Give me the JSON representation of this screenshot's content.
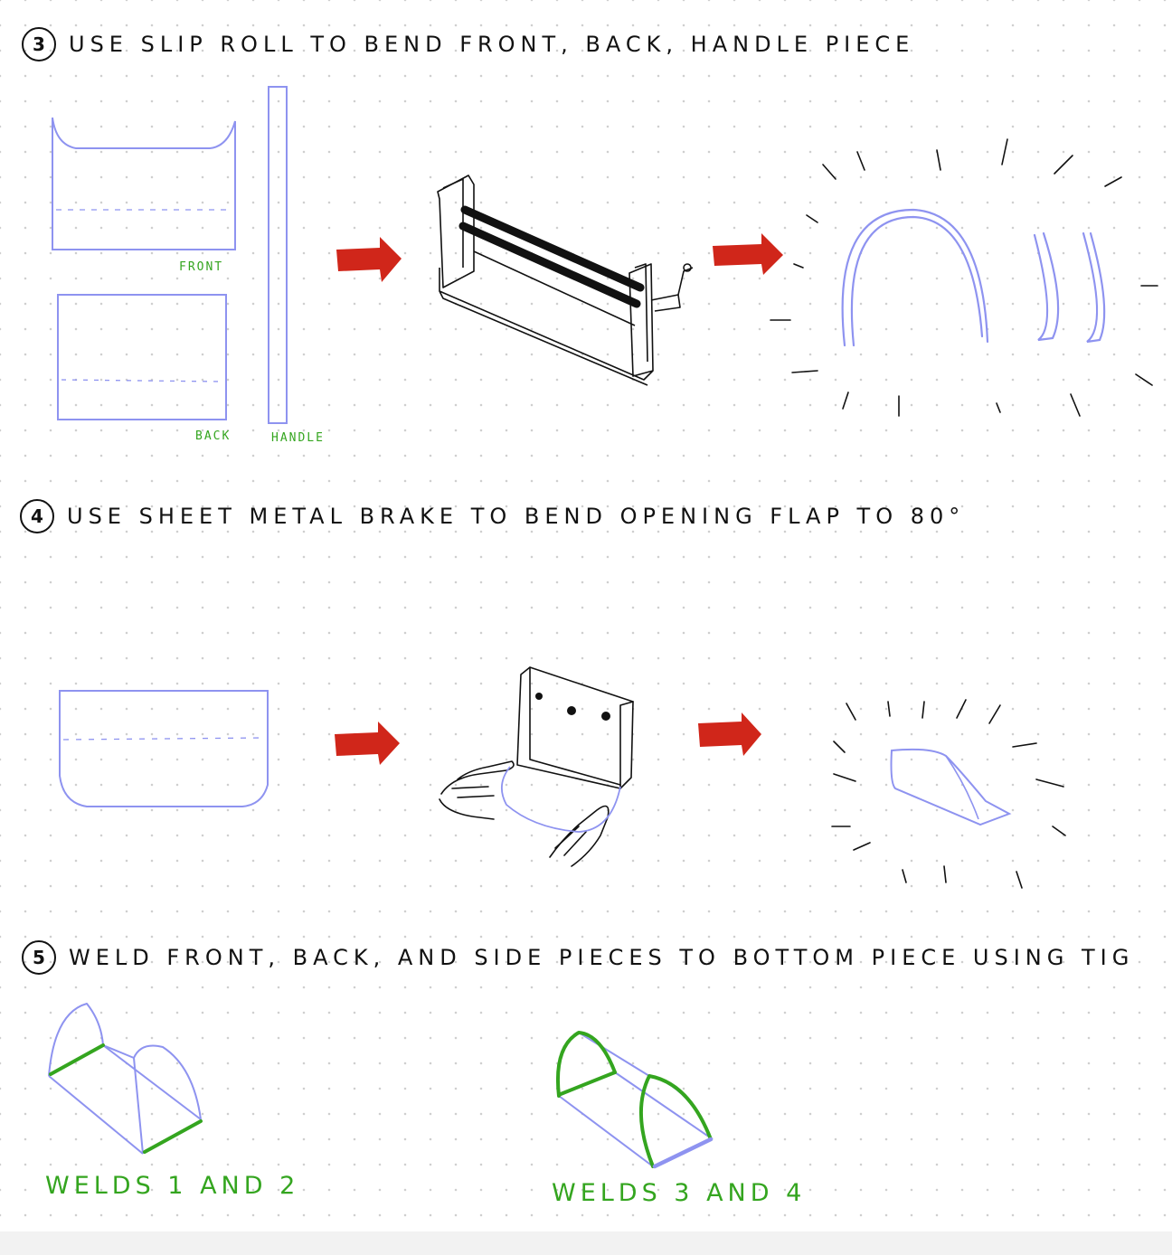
{
  "steps": [
    {
      "number": "3",
      "text": "USE SLIP ROLL TO BEND FRONT, BACK, HANDLE PIECE"
    },
    {
      "number": "4",
      "text": "USE SHEET METAL BRAKE TO BEND OPENING FLAP TO 80°"
    },
    {
      "number": "5",
      "text": "WELD FRONT, BACK, AND SIDE PIECES TO BOTTOM PIECE USING TIG"
    }
  ],
  "labels": {
    "front": "FRONT",
    "back": "BACK",
    "handle": "HANDLE",
    "welds_a": "WELDS 1 AND 2",
    "welds_b": "WELDS 3 AND 4"
  },
  "colors": {
    "sketch_blue": "#8e93f0",
    "weld_green": "#34a51f",
    "arrow_red": "#d0261a",
    "ink": "#111111"
  }
}
